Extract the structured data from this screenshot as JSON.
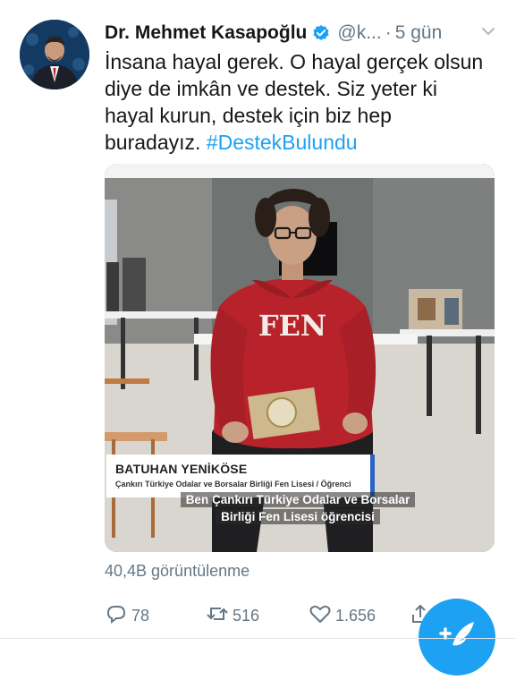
{
  "tweet": {
    "author_name": "Dr. Mehmet Kasapoğlu",
    "handle": "@k...",
    "separator": "·",
    "time": "5 gün",
    "text": "İnsana hayal gerek. O hayal gerçek olsun diye de imkân ve destek. Siz yeter ki hayal kurun, destek için biz hep buradayız.",
    "hashtag": "#DestekBulundu"
  },
  "video": {
    "lower_third_name": "BATUHAN YENİKÖSE",
    "lower_third_subtitle": "Çankırı Türkiye Odalar ve Borsalar Birliği Fen Lisesi / Öğrenci",
    "caption_line1": "Ben Çankırı Türkiye Odalar ve Borsalar",
    "caption_line2": "Birliği Fen Lisesi öğrencisi",
    "shirt_text": "FEN"
  },
  "stats": {
    "views": "40,4B görüntülenme",
    "replies": "78",
    "retweets": "516",
    "likes": "1.656"
  },
  "colors": {
    "accent": "#1da1f2",
    "muted": "#657786",
    "text": "#14171a"
  },
  "icons": [
    "verified-badge-icon",
    "chevron-down-icon",
    "reply-icon",
    "retweet-icon",
    "like-icon",
    "share-icon",
    "compose-icon"
  ]
}
